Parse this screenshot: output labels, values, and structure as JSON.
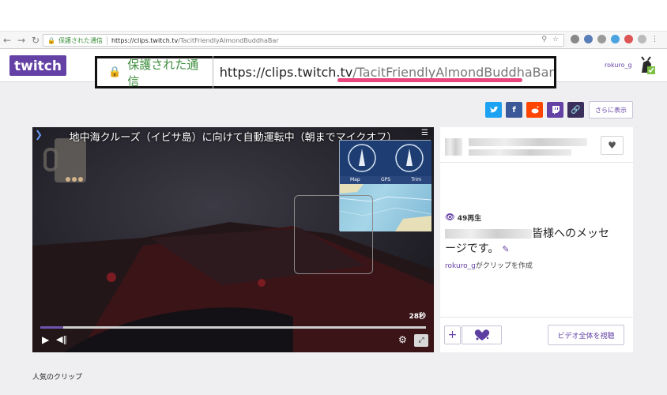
{
  "browser": {
    "secure_label": "保護された通信",
    "url_host": "https://clips.twitch.tv",
    "url_path": "/TacitFriendlyAlmondBuddhaBar"
  },
  "header": {
    "brand": "twitch",
    "username": "rokuro_g"
  },
  "share": {
    "more_label": "さらに表示",
    "buttons": [
      "twitter",
      "facebook",
      "reddit",
      "twitch",
      "link"
    ]
  },
  "player": {
    "title": "地中海クルーズ（イビサ島）に向けて自動運転中（朝までマイクオフ）",
    "duration": "28秒",
    "progress": 0.06,
    "inset_tabs": [
      "Map",
      "GPS",
      "Trim"
    ]
  },
  "clip_info": {
    "views": "49再生",
    "title": "皆様へのメッセージです。",
    "creator_user": "rokuro_g",
    "creator_suffix": "がクリップを作成",
    "watch_full_label": "ビデオ全体を視聴"
  },
  "section": {
    "popular_label": "人気のクリップ"
  },
  "colors": {
    "twitch_purple": "#6441a4",
    "secure_green": "#3b8d3b",
    "highlight_underline": "#e8467c"
  }
}
